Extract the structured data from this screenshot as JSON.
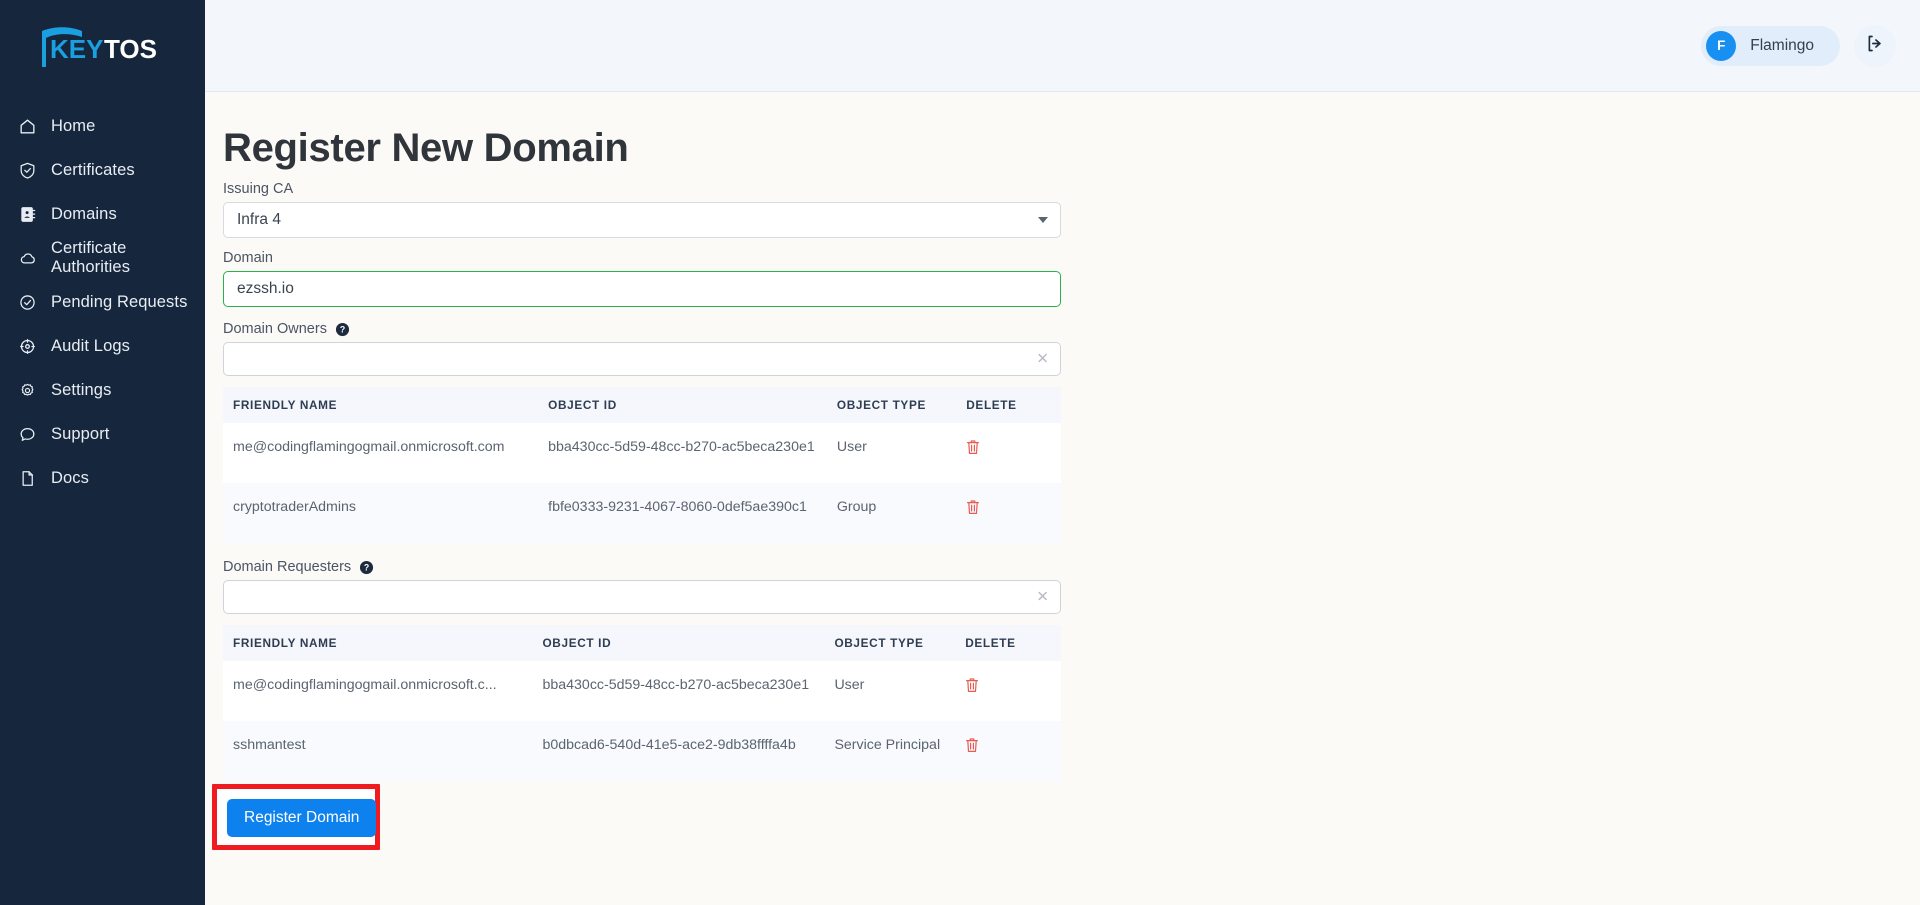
{
  "brand": {
    "name_part1": "KEY",
    "name_part2": "TOS",
    "accent": "#1a9fe0"
  },
  "sidebar": {
    "items": [
      {
        "label": "Home",
        "icon": "home-icon"
      },
      {
        "label": "Certificates",
        "icon": "shield-check-icon"
      },
      {
        "label": "Domains",
        "icon": "address-book-icon"
      },
      {
        "label": "Certificate Authorities",
        "icon": "cloud-icon"
      },
      {
        "label": "Pending Requests",
        "icon": "check-circle-icon"
      },
      {
        "label": "Audit Logs",
        "icon": "compass-icon"
      },
      {
        "label": "Settings",
        "icon": "gear-icon"
      },
      {
        "label": "Support",
        "icon": "chat-bubble-icon"
      },
      {
        "label": "Docs",
        "icon": "document-icon"
      }
    ]
  },
  "topbar": {
    "user_initial": "F",
    "user_name": "Flamingo",
    "logout_icon": "logout-icon"
  },
  "page": {
    "title": "Register New Domain"
  },
  "form": {
    "issuing_ca": {
      "label": "Issuing CA",
      "value": "Infra 4"
    },
    "domain": {
      "label": "Domain",
      "value": "ezssh.io",
      "placeholder": ""
    },
    "owners": {
      "label": "Domain Owners",
      "help_icon": "question-circle-icon",
      "input_value": "",
      "input_placeholder": "",
      "clear_icon": "close-icon",
      "columns": [
        "FRIENDLY NAME",
        "OBJECT ID",
        "OBJECT TYPE",
        "DELETE"
      ],
      "rows": [
        {
          "friendly_name": "me@codingflamingogmail.onmicrosoft.com",
          "object_id": "bba430cc-5d59-48cc-b270-ac5beca230e1",
          "object_type": "User",
          "delete_icon": "trash-icon"
        },
        {
          "friendly_name": "cryptotraderAdmins",
          "object_id": "fbfe0333-9231-4067-8060-0def5ae390c1",
          "object_type": "Group",
          "delete_icon": "trash-icon"
        }
      ]
    },
    "requesters": {
      "label": "Domain Requesters",
      "help_icon": "question-circle-icon",
      "input_value": "",
      "input_placeholder": "",
      "clear_icon": "close-icon",
      "columns": [
        "FRIENDLY NAME",
        "OBJECT ID",
        "OBJECT TYPE",
        "DELETE"
      ],
      "rows": [
        {
          "friendly_name": "me@codingflamingogmail.onmicrosoft.c...",
          "object_id": "bba430cc-5d59-48cc-b270-ac5beca230e1",
          "object_type": "User",
          "delete_icon": "trash-icon"
        },
        {
          "friendly_name": "sshmantest",
          "object_id": "b0dbcad6-540d-41e5-ace2-9db38ffffa4b",
          "object_type": "Service Principal",
          "delete_icon": "trash-icon"
        }
      ]
    },
    "submit": {
      "label": "Register Domain",
      "color": "#0d82ef",
      "highlight_color": "#ee1c20"
    }
  }
}
